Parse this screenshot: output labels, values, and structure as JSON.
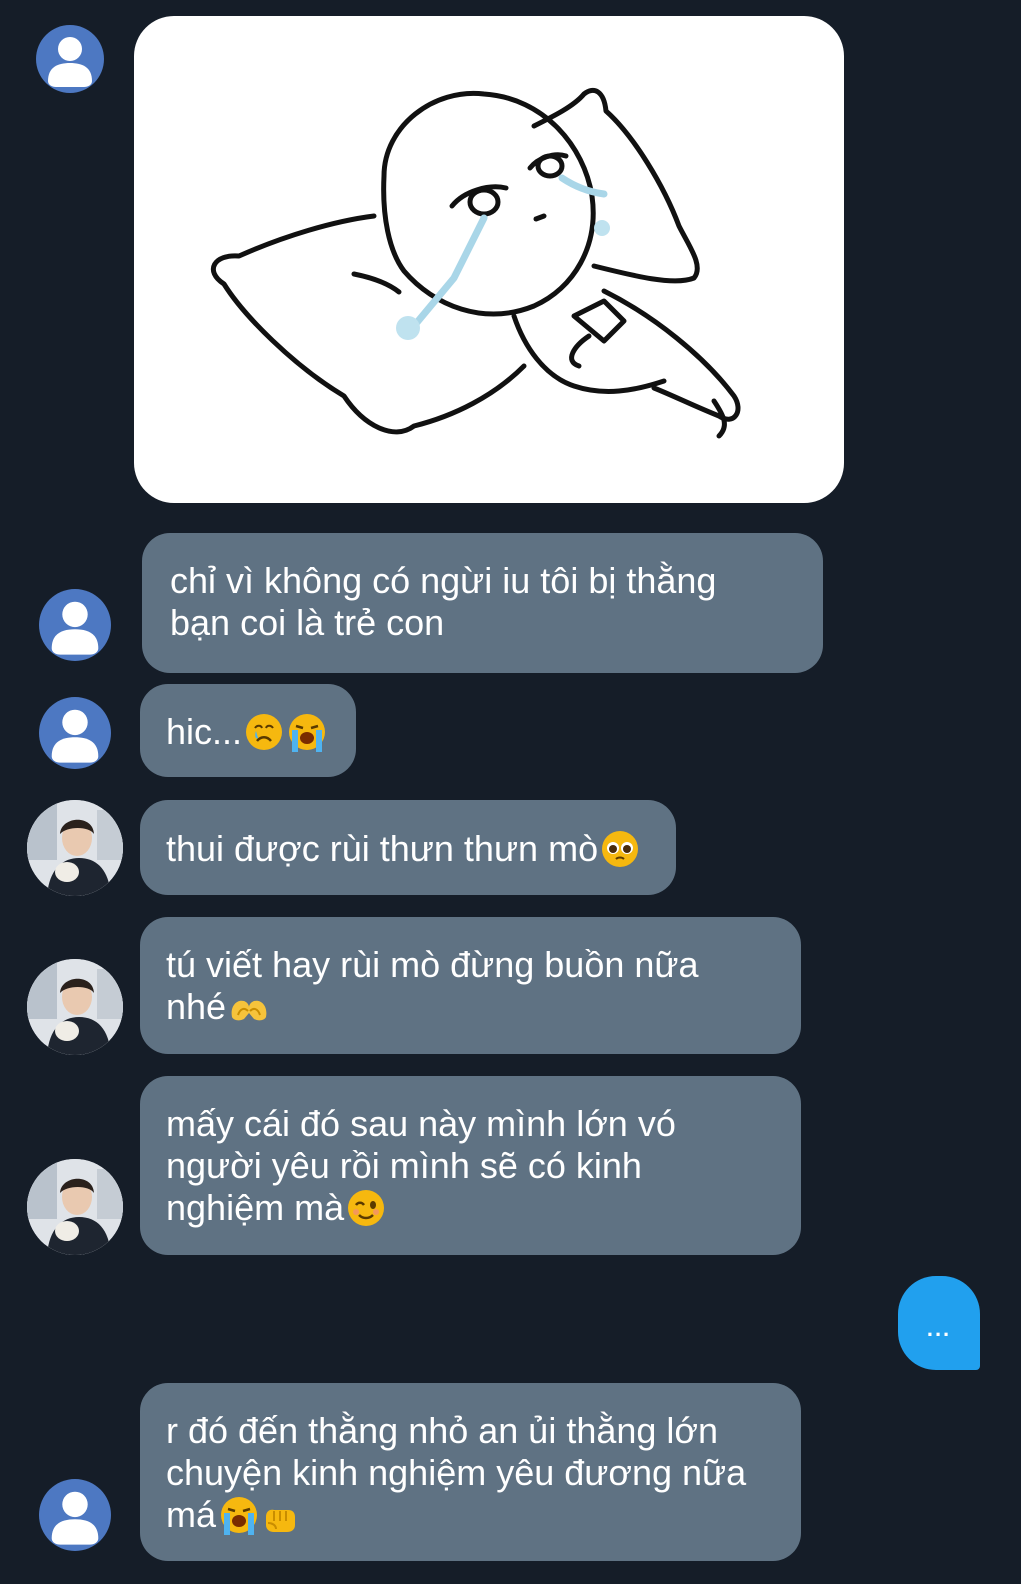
{
  "messages": [
    {
      "id": "m1",
      "type": "sticker",
      "sender": "default",
      "sticker_name": "crying-pillow-sticker"
    },
    {
      "id": "m2",
      "type": "text",
      "sender": "default",
      "lines": [
        "chỉ vì không có ngừi iu tôi bị thằng",
        "bạn coi là trẻ con"
      ]
    },
    {
      "id": "m3",
      "type": "text",
      "sender": "default",
      "lines": [
        "hic..."
      ],
      "emojis": [
        "crying-face-emoji",
        "loudly-crying-face-emoji"
      ]
    },
    {
      "id": "m4",
      "type": "text",
      "sender": "photo",
      "lines": [
        "thui được rùi thưn thưn mò"
      ],
      "emojis": [
        "pleading-face-emoji"
      ]
    },
    {
      "id": "m5",
      "type": "text",
      "sender": "photo",
      "lines": [
        "tú viết hay rùi mò đừng buồn nữa",
        "nhé"
      ],
      "emojis": [
        "heart-hands-emoji"
      ]
    },
    {
      "id": "m6",
      "type": "text",
      "sender": "photo",
      "lines": [
        "mấy cái đó sau này mình lớn vó",
        "người yêu rồi mình sẽ có kinh",
        "nghiệm mà"
      ],
      "emojis": [
        "winking-face-emoji"
      ]
    },
    {
      "id": "m7",
      "type": "typing",
      "sender": "self",
      "text": "..."
    },
    {
      "id": "m8",
      "type": "text",
      "sender": "default",
      "lines": [
        "r đó đến thằng nhỏ an ủi thằng lớn",
        "chuyện kinh nghiệm yêu đương nữa",
        "má"
      ],
      "emojis": [
        "loudly-crying-face-emoji",
        "oncoming-fist-emoji"
      ]
    }
  ],
  "colors": {
    "background": "#151d28",
    "bubble": "#5f7283",
    "typing_bubble": "#21a0ee",
    "default_avatar": "#4d78c2"
  }
}
